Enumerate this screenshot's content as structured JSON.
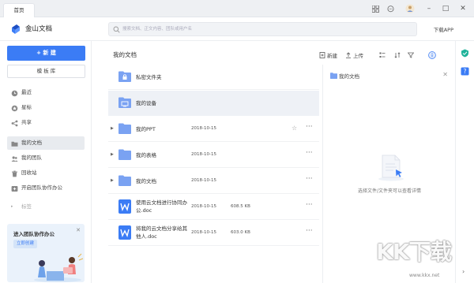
{
  "titlebar": {
    "tab_label": "首页"
  },
  "header": {
    "app_title": "金山文档",
    "search_placeholder": "搜索文档、正文内容、团队或用户名",
    "download_label": "下载APP"
  },
  "sidebar": {
    "new_label": "+ 新 建",
    "template_label": "模 板 库",
    "nav_items": [
      {
        "label": "最近",
        "icon": "clock-icon"
      },
      {
        "label": "星标",
        "icon": "star-icon"
      },
      {
        "label": "共享",
        "icon": "share-icon"
      },
      {
        "label": "我的文档",
        "icon": "folder-icon"
      },
      {
        "label": "我的团队",
        "icon": "team-icon"
      },
      {
        "label": "回收站",
        "icon": "trash-icon"
      },
      {
        "label": "开启团队协作办公",
        "icon": "team-plus-icon"
      }
    ],
    "tags_label": "标签",
    "promo": {
      "title": "进入团队协作办公",
      "button": "立即创建"
    }
  },
  "main": {
    "title": "我的文档",
    "toolbar": {
      "new_label": "新建",
      "upload_label": "上传"
    },
    "rows": [
      {
        "name": "私密文件夹",
        "date": "",
        "size": "",
        "type": "folder-lock"
      },
      {
        "name": "我的设备",
        "date": "",
        "size": "",
        "type": "folder-device"
      },
      {
        "name": "我的PPT",
        "date": "2018-10-15",
        "size": "",
        "type": "folder"
      },
      {
        "name": "我的表格",
        "date": "2018-10-15",
        "size": "",
        "type": "folder"
      },
      {
        "name": "我的文档",
        "date": "2018-10-15",
        "size": "",
        "type": "folder"
      },
      {
        "name": "使用云文档进行协同办公.doc",
        "date": "2018-10-15",
        "size": "608.5 KB",
        "type": "word"
      },
      {
        "name": "将我的云文档分享给其他人.doc",
        "date": "2018-10-15",
        "size": "603.0 KB",
        "type": "word"
      }
    ]
  },
  "detail": {
    "title": "我的文档",
    "hint": "选择文件/文件夹可以查看详情"
  },
  "watermark": {
    "text": "KK下载",
    "url": "www.kkx.net"
  },
  "colors": {
    "accent": "#3b7cf5",
    "folder": "#7aa2f2",
    "word": "#3b7cf5"
  }
}
